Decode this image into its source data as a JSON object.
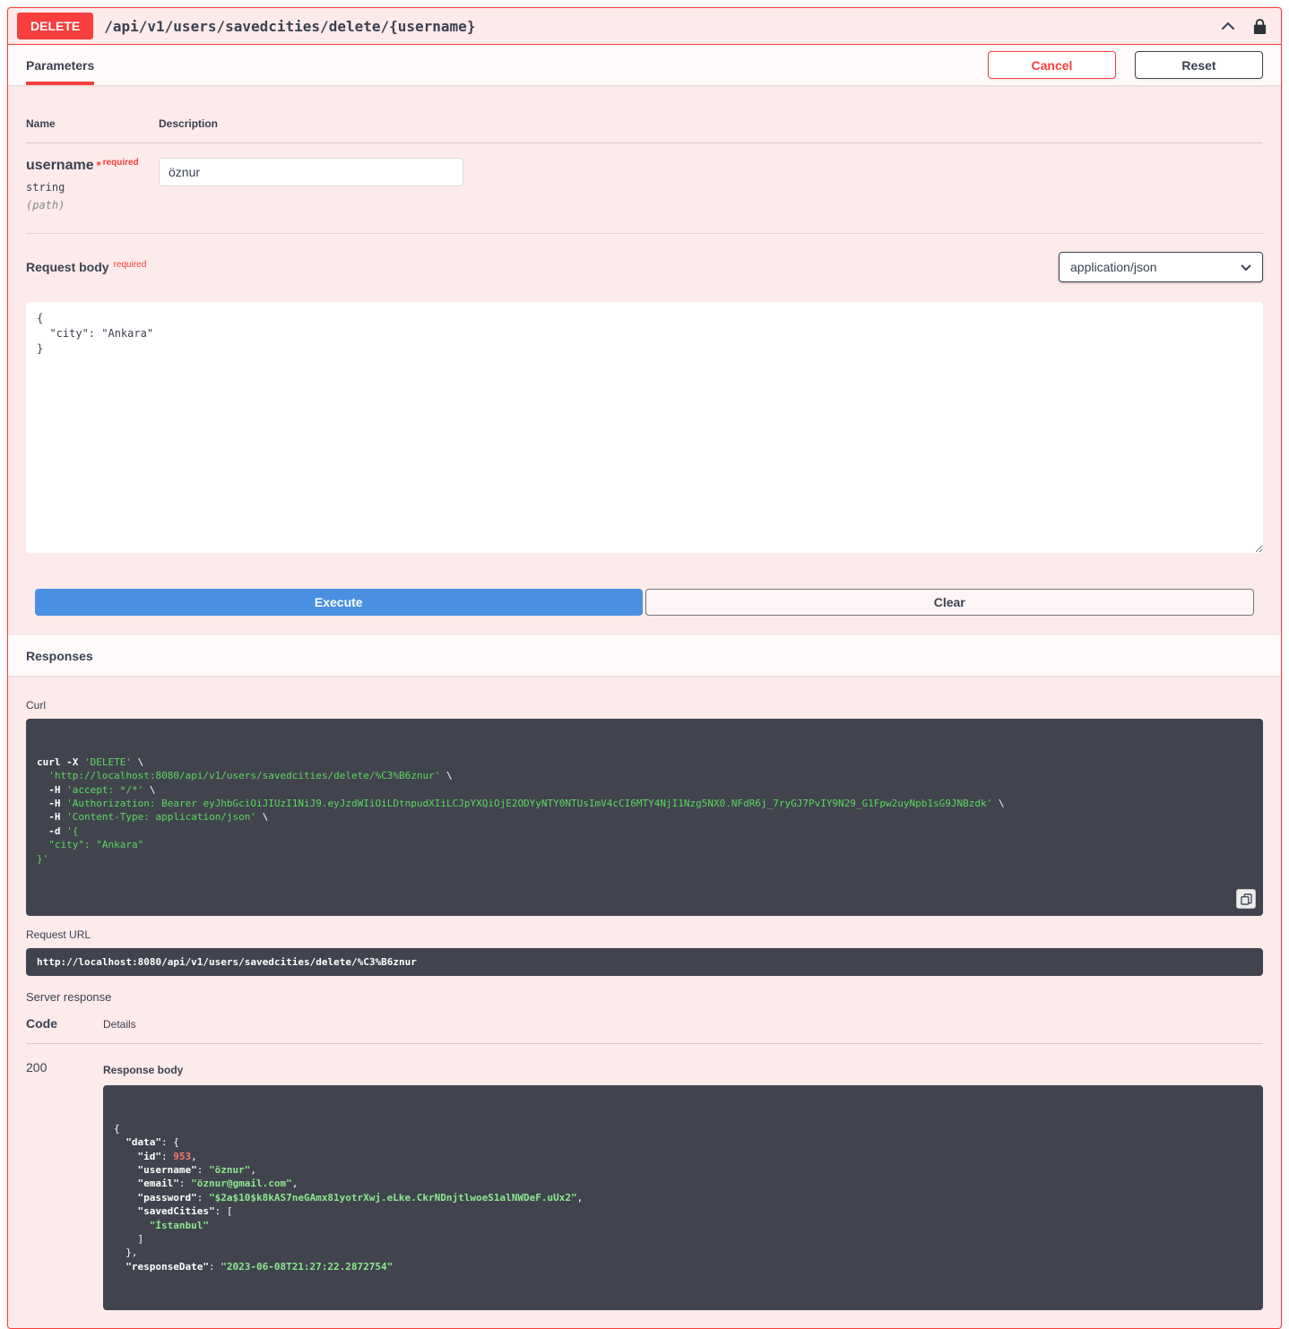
{
  "endpoint": {
    "method": "DELETE",
    "path": "/api/v1/users/savedcities/delete/{username}"
  },
  "parameters_section": {
    "tab_label": "Parameters",
    "cancel_label": "Cancel",
    "reset_label": "Reset",
    "name_header": "Name",
    "description_header": "Description",
    "param": {
      "name": "username",
      "required_star": "*",
      "required_label": "required",
      "type": "string",
      "location": "(path)",
      "value": "öznur"
    }
  },
  "request_body": {
    "label": "Request body",
    "required_label": "required",
    "content_type": "application/json",
    "body_text": "{\n  \"city\": \"Ankara\"\n}"
  },
  "actions": {
    "execute_label": "Execute",
    "clear_label": "Clear"
  },
  "responses": {
    "section_title": "Responses",
    "curl_label": "Curl",
    "curl_lines": [
      [
        [
          "b",
          "curl"
        ],
        [
          "p",
          " "
        ],
        [
          "b",
          "-X"
        ],
        [
          "p",
          " "
        ],
        [
          "s",
          "'DELETE'"
        ],
        [
          "p",
          " \\"
        ]
      ],
      [
        [
          "p",
          "  "
        ],
        [
          "s",
          "'http://localhost:8080/api/v1/users/savedcities/delete/%C3%B6znur'"
        ],
        [
          "p",
          " \\"
        ]
      ],
      [
        [
          "p",
          "  "
        ],
        [
          "b",
          "-H"
        ],
        [
          "p",
          " "
        ],
        [
          "s",
          "'accept: */*'"
        ],
        [
          "p",
          " \\"
        ]
      ],
      [
        [
          "p",
          "  "
        ],
        [
          "b",
          "-H"
        ],
        [
          "p",
          " "
        ],
        [
          "s",
          "'Authorization: Bearer eyJhbGciOiJIUzI1NiJ9.eyJzdWIiOiLDtnpudXIiLCJpYXQiOjE2ODYyNTY0NTUsImV4cCI6MTY4NjI1Nzg5NX0.NFdR6j_7ryGJ7PvIY9N29_G1Fpw2uyNpb1sG9JNBzdk'"
        ],
        [
          "p",
          " \\"
        ]
      ],
      [
        [
          "p",
          "  "
        ],
        [
          "b",
          "-H"
        ],
        [
          "p",
          " "
        ],
        [
          "s",
          "'Content-Type: application/json'"
        ],
        [
          "p",
          " \\"
        ]
      ],
      [
        [
          "p",
          "  "
        ],
        [
          "b",
          "-d"
        ],
        [
          "p",
          " "
        ],
        [
          "s",
          "'{"
        ]
      ],
      [
        [
          "s",
          "  \"city\": \"Ankara\""
        ]
      ],
      [
        [
          "s",
          "}'"
        ]
      ]
    ],
    "request_url_label": "Request URL",
    "request_url": "http://localhost:8080/api/v1/users/savedcities/delete/%C3%B6znur",
    "server_response_label": "Server response",
    "code_header": "Code",
    "details_header": "Details",
    "status_code": "200",
    "response_body_label": "Response body",
    "response_body_lines": [
      [
        [
          "p",
          "{"
        ]
      ],
      [
        [
          "p",
          "  "
        ],
        [
          "k",
          "\"data\""
        ],
        [
          "p",
          ": {"
        ]
      ],
      [
        [
          "p",
          "    "
        ],
        [
          "k",
          "\"id\""
        ],
        [
          "p",
          ": "
        ],
        [
          "n",
          "953"
        ],
        [
          "p",
          ","
        ]
      ],
      [
        [
          "p",
          "    "
        ],
        [
          "k",
          "\"username\""
        ],
        [
          "p",
          ": "
        ],
        [
          "g",
          "\"öznur\""
        ],
        [
          "p",
          ","
        ]
      ],
      [
        [
          "p",
          "    "
        ],
        [
          "k",
          "\"email\""
        ],
        [
          "p",
          ": "
        ],
        [
          "g",
          "\"öznur@gmail.com\""
        ],
        [
          "p",
          ","
        ]
      ],
      [
        [
          "p",
          "    "
        ],
        [
          "k",
          "\"password\""
        ],
        [
          "p",
          ": "
        ],
        [
          "g",
          "\"$2a$10$k8kAS7neGAmx81yotrXwj.eLke.CkrNDnjtlwoeS1alNWDeF.uUx2\""
        ],
        [
          "p",
          ","
        ]
      ],
      [
        [
          "p",
          "    "
        ],
        [
          "k",
          "\"savedCities\""
        ],
        [
          "p",
          ": ["
        ]
      ],
      [
        [
          "p",
          "      "
        ],
        [
          "g",
          "\"İstanbul\""
        ]
      ],
      [
        [
          "p",
          "    ]"
        ]
      ],
      [
        [
          "p",
          "  },"
        ]
      ],
      [
        [
          "p",
          "  "
        ],
        [
          "k",
          "\"responseDate\""
        ],
        [
          "p",
          ": "
        ],
        [
          "g",
          "\"2023-06-08T21:27:22.2872754\""
        ]
      ]
    ]
  },
  "colors": {
    "method_red": "#f93e3e",
    "execute_blue": "#4990e2",
    "code_background": "#41444e",
    "string_green": "#5bd75b",
    "number_red": "#f77669"
  }
}
